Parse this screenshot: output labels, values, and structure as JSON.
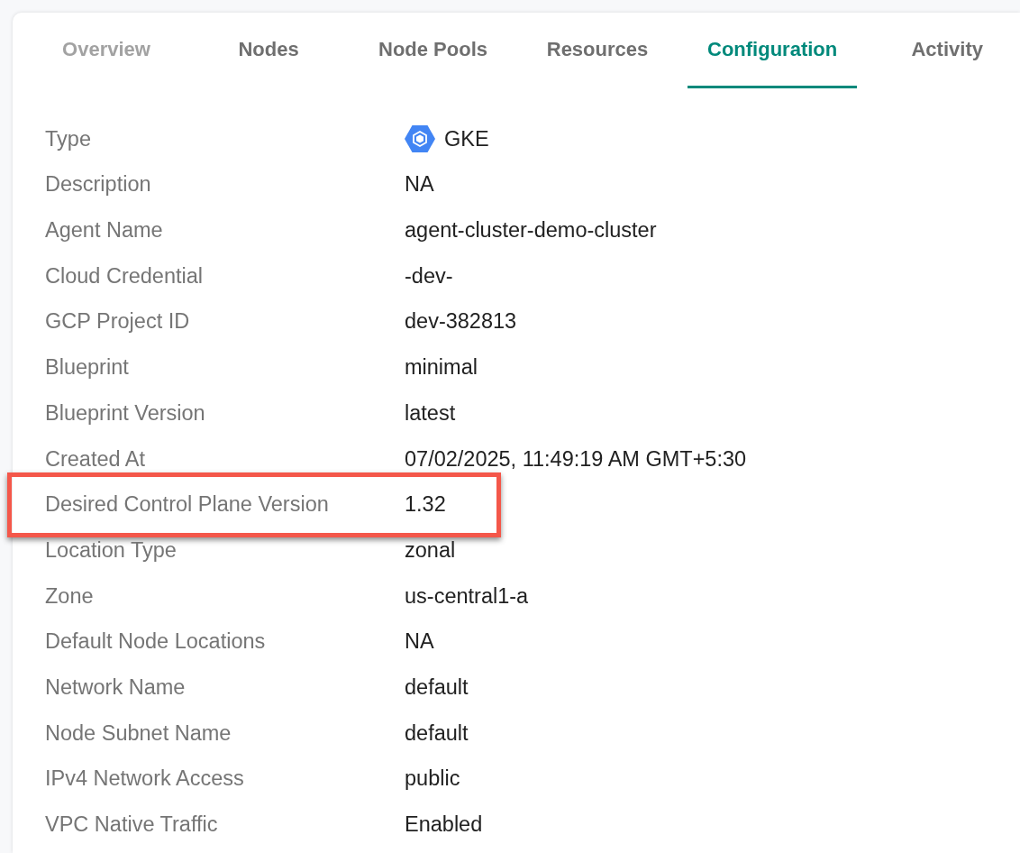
{
  "tabs": [
    {
      "label": "Overview",
      "selected": false,
      "disabled": true
    },
    {
      "label": "Nodes",
      "selected": false,
      "disabled": false
    },
    {
      "label": "Node Pools",
      "selected": false,
      "disabled": false
    },
    {
      "label": "Resources",
      "selected": false,
      "disabled": false
    },
    {
      "label": "Configuration",
      "selected": true,
      "disabled": false
    },
    {
      "label": "Activity",
      "selected": false,
      "disabled": false
    }
  ],
  "details": [
    {
      "label": "Type",
      "value": "GKE",
      "kind": "icon",
      "highlighted": false
    },
    {
      "label": "Description",
      "value": "NA",
      "kind": "text",
      "highlighted": false
    },
    {
      "label": "Agent Name",
      "value": "agent-cluster-demo-cluster",
      "kind": "text",
      "highlighted": false
    },
    {
      "label": "Cloud Credential",
      "value": "-dev-",
      "kind": "text",
      "highlighted": false
    },
    {
      "label": "GCP Project ID",
      "value": "dev-382813",
      "kind": "text",
      "highlighted": false
    },
    {
      "label": "Blueprint",
      "value": "minimal",
      "kind": "text",
      "highlighted": false
    },
    {
      "label": "Blueprint Version",
      "value": "latest",
      "kind": "text",
      "highlighted": false
    },
    {
      "label": "Created At",
      "value": "07/02/2025, 11:49:19 AM GMT+5:30",
      "kind": "text",
      "highlighted": false
    },
    {
      "label": "Desired Control Plane Version",
      "value": "1.32",
      "kind": "text",
      "highlighted": true
    },
    {
      "label": "Location Type",
      "value": "zonal",
      "kind": "text",
      "highlighted": false
    },
    {
      "label": "Zone",
      "value": "us-central1-a",
      "kind": "text",
      "highlighted": false
    },
    {
      "label": "Default Node Locations",
      "value": "NA",
      "kind": "text",
      "highlighted": false
    },
    {
      "label": "Network Name",
      "value": "default",
      "kind": "text",
      "highlighted": false
    },
    {
      "label": "Node Subnet Name",
      "value": "default",
      "kind": "text",
      "highlighted": false
    },
    {
      "label": "IPv4 Network Access",
      "value": "public",
      "kind": "text",
      "highlighted": false
    },
    {
      "label": "VPC Native Traffic",
      "value": "Enabled",
      "kind": "text",
      "highlighted": false
    }
  ]
}
